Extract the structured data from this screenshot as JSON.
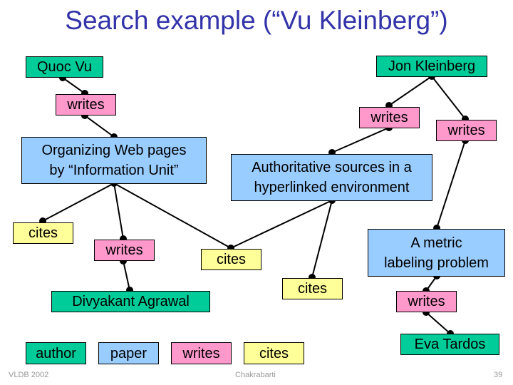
{
  "slide": {
    "title": "Search example (“Vu Kleinberg”)",
    "footer_left": "VLDB 2002",
    "footer_center": "Chakrabarti",
    "page_number": "39"
  },
  "colors": {
    "title": "#3333aa",
    "author": "#00cc99",
    "paper": "#99ccff",
    "writes": "#ff99cc",
    "cites": "#ffff99"
  },
  "nodes": {
    "quoc_vu": {
      "label": "Quoc Vu",
      "type": "author"
    },
    "jon_kleinberg": {
      "label": "Jon Kleinberg",
      "type": "author"
    },
    "writes_qv": {
      "label": "writes",
      "type": "writes"
    },
    "writes_jk1": {
      "label": "writes",
      "type": "writes"
    },
    "writes_jk2": {
      "label": "writes",
      "type": "writes"
    },
    "paper_web_pages": {
      "line1": "Organizing Web pages",
      "line2": "by “Information Unit”",
      "type": "paper"
    },
    "paper_authoritative": {
      "line1": "Authoritative sources in a",
      "line2": "hyperlinked environment",
      "type": "paper"
    },
    "paper_metric": {
      "line1": "A metric",
      "line2": "labeling problem",
      "type": "paper"
    },
    "cites_left": {
      "label": "cites",
      "type": "cites"
    },
    "writes_da": {
      "label": "writes",
      "type": "writes"
    },
    "cites_mid": {
      "label": "cites",
      "type": "cites"
    },
    "cites_right": {
      "label": "cites",
      "type": "cites"
    },
    "divyakant": {
      "label": "Divyakant Agrawal",
      "type": "author"
    },
    "writes_et": {
      "label": "writes",
      "type": "writes"
    },
    "eva_tardos": {
      "label": "Eva Tardos",
      "type": "author"
    }
  },
  "edges": [
    [
      "quoc_vu",
      "writes_qv"
    ],
    [
      "writes_qv",
      "paper_web_pages"
    ],
    [
      "jon_kleinberg",
      "writes_jk1"
    ],
    [
      "jon_kleinberg",
      "writes_jk2"
    ],
    [
      "writes_jk1",
      "paper_authoritative"
    ],
    [
      "writes_jk2",
      "paper_metric"
    ],
    [
      "paper_web_pages",
      "cites_left"
    ],
    [
      "paper_web_pages",
      "writes_da"
    ],
    [
      "paper_web_pages",
      "cites_mid"
    ],
    [
      "cites_mid",
      "paper_authoritative"
    ],
    [
      "paper_authoritative",
      "cites_right"
    ],
    [
      "writes_da",
      "divyakant"
    ],
    [
      "paper_metric",
      "writes_et"
    ],
    [
      "writes_et",
      "eva_tardos"
    ]
  ],
  "legend": [
    {
      "label": "author",
      "type": "author"
    },
    {
      "label": "paper",
      "type": "paper"
    },
    {
      "label": "writes",
      "type": "writes"
    },
    {
      "label": "cites",
      "type": "cites"
    }
  ]
}
